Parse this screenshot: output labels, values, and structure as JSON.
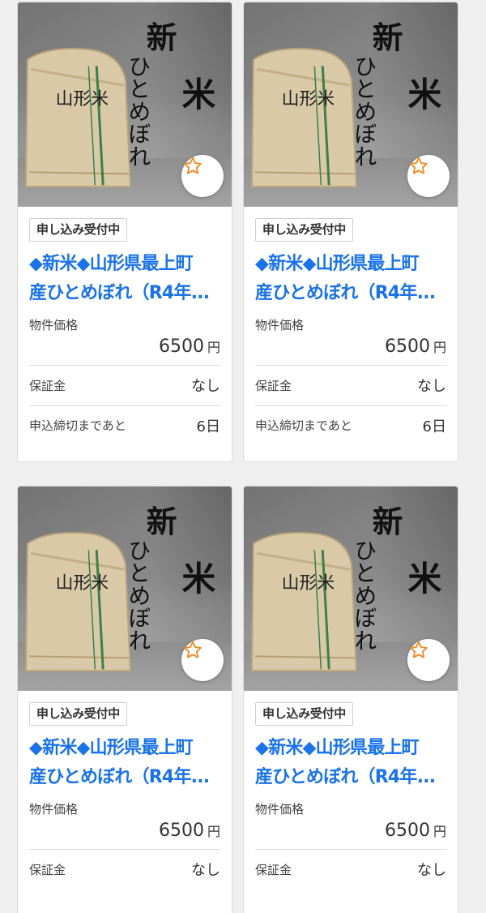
{
  "listings": [
    {
      "status_badge": "申し込み受付中",
      "title_line1": "◆新米◆山形県最上町",
      "title_line2": "産ひとめぼれ（R4年...",
      "price_label": "物件価格",
      "price_value": "6500",
      "price_unit": "円",
      "deposit_label": "保証金",
      "deposit_value": "なし",
      "deadline_label": "申込締切まであと",
      "deadline_value": "6日",
      "image_text": {
        "bag_label": "山形米",
        "banner1": "新",
        "banner2": "米",
        "banner3": "ひとめぼれ"
      },
      "favorite_icon": "star-outline-icon"
    },
    {
      "status_badge": "申し込み受付中",
      "title_line1": "◆新米◆山形県最上町",
      "title_line2": "産ひとめぼれ（R4年...",
      "price_label": "物件価格",
      "price_value": "6500",
      "price_unit": "円",
      "deposit_label": "保証金",
      "deposit_value": "なし",
      "deadline_label": "申込締切まであと",
      "deadline_value": "6日",
      "image_text": {
        "bag_label": "山形米",
        "banner1": "新",
        "banner2": "米",
        "banner3": "ひとめぼれ"
      },
      "favorite_icon": "star-outline-icon"
    },
    {
      "status_badge": "申し込み受付中",
      "title_line1": "◆新米◆山形県最上町",
      "title_line2": "産ひとめぼれ（R4年...",
      "price_label": "物件価格",
      "price_value": "6500",
      "price_unit": "円",
      "deposit_label": "保証金",
      "deposit_value": "なし",
      "image_text": {
        "bag_label": "山形米",
        "banner1": "新",
        "banner2": "米",
        "banner3": "ひとめぼれ"
      },
      "favorite_icon": "star-outline-icon"
    },
    {
      "status_badge": "申し込み受付中",
      "title_line1": "◆新米◆山形県最上町",
      "title_line2": "産ひとめぼれ（R4年...",
      "price_label": "物件価格",
      "price_value": "6500",
      "price_unit": "円",
      "deposit_label": "保証金",
      "deposit_value": "なし",
      "image_text": {
        "bag_label": "山形米",
        "banner1": "新",
        "banner2": "米",
        "banner3": "ひとめぼれ"
      },
      "favorite_icon": "star-outline-icon"
    }
  ],
  "colors": {
    "title_link": "#1a73e8",
    "star_icon": "#f08a24",
    "background": "#efefef"
  }
}
